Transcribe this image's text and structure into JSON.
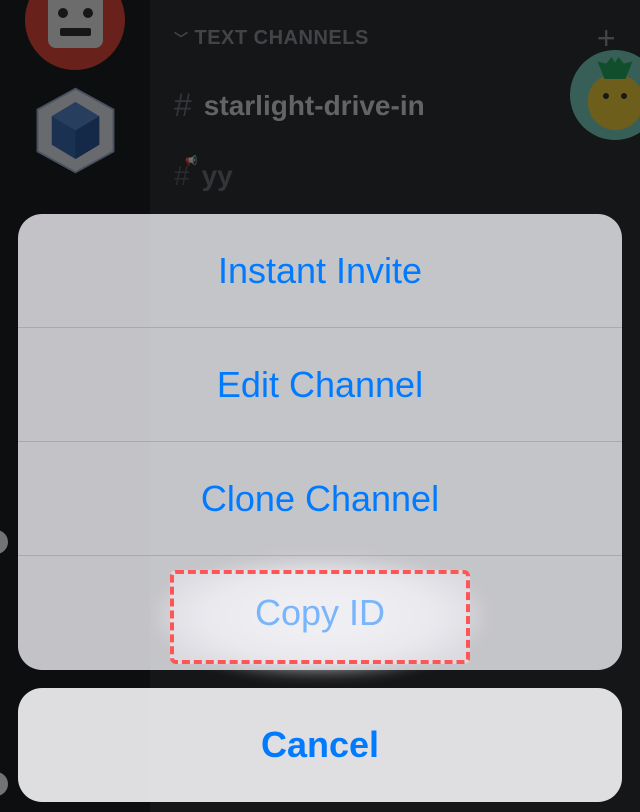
{
  "sidebar": {
    "category_label": "TEXT CHANNELS",
    "channels": [
      {
        "name": "starlight-drive-in"
      },
      {
        "name": "yy"
      }
    ]
  },
  "action_sheet": {
    "items": [
      {
        "label": "Instant Invite"
      },
      {
        "label": "Edit Channel"
      },
      {
        "label": "Clone Channel"
      },
      {
        "label": "Copy ID"
      }
    ],
    "cancel_label": "Cancel"
  },
  "highlight": {
    "target": "Copy ID"
  }
}
